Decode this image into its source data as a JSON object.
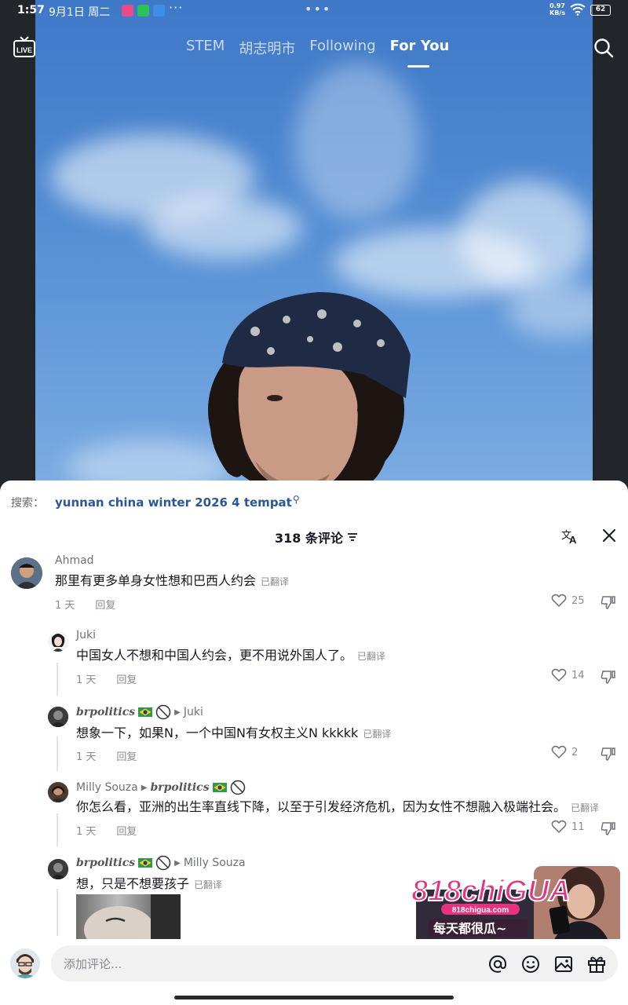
{
  "status_bar": {
    "time": "1:57",
    "date": "9月1日 周二",
    "overflow": "···",
    "center_dots": "•••",
    "net_speed": "0.97",
    "net_unit": "KB/s",
    "battery": "62"
  },
  "top_nav": {
    "live_label": "LIVE",
    "tabs": [
      {
        "label": "STEM"
      },
      {
        "label": "胡志明市"
      },
      {
        "label": "Following"
      },
      {
        "label": "For You",
        "active": true
      }
    ]
  },
  "comments_panel": {
    "search_prefix": "搜索：",
    "search_query": "yunnan china winter 2026 4 tempat",
    "count_title": "318 条评论",
    "comments": [
      {
        "user": "Ahmad",
        "text": "那里有更多单身女性想和巴西人约会",
        "translated_tag": "已翻译",
        "time": "1 天",
        "reply_label": "回复",
        "likes": "25"
      },
      {
        "user": "Juki",
        "text": "中国女人不想和中国人约会，更不用说外国人了。",
        "translated_tag": "已翻译",
        "time": "1 天",
        "reply_label": "回复",
        "likes": "14"
      },
      {
        "user": "brpolitics",
        "reply_to": "Juki",
        "text": "想象一下，如果N，一个中国N有女权主义N kkkkk",
        "translated_tag": "已翻译",
        "time": "1 天",
        "reply_label": "回复",
        "likes": "2"
      },
      {
        "user": "Milly Souza",
        "reply_to": "brpolitics",
        "text": "你怎么看，亚洲的出生率直线下降，以至于引发经济危机，因为女性不想融入极端社会。",
        "translated_tag": "已翻译",
        "time": "1 天",
        "reply_label": "回复",
        "likes": "11"
      },
      {
        "user": "brpolitics",
        "reply_to": "Milly Souza",
        "text": "想，只是不想要孩子",
        "translated_tag": "已翻译"
      }
    ]
  },
  "ad": {
    "brand": "818chiGUA",
    "url": "818chigua.com",
    "slogan": "每天都很瓜~"
  },
  "input_bar": {
    "placeholder": "添加评论..."
  },
  "colors": {
    "link_blue": "#2b5797",
    "text_primary": "#161823",
    "text_secondary": "#8a8b91",
    "ad_pink": "#e8327f"
  }
}
